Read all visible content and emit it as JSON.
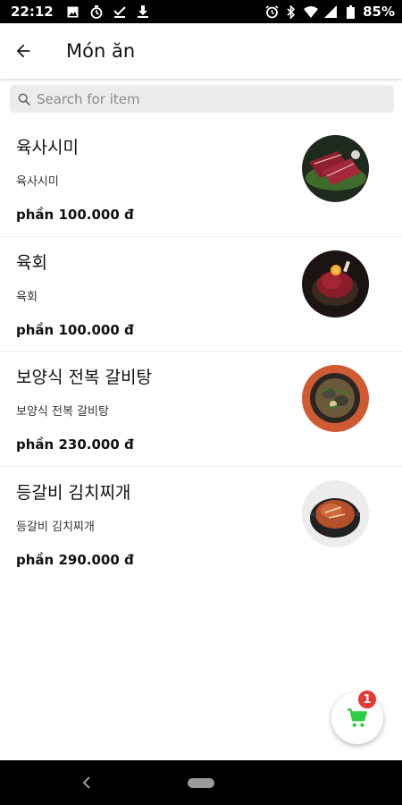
{
  "status_bar": {
    "time": "22:12",
    "battery": "85%",
    "left_icons": [
      "image-icon",
      "timer-icon",
      "check-icon",
      "download-icon"
    ],
    "right_icons": [
      "alarm-icon",
      "bluetooth-icon",
      "wifi-icon",
      "signal-icon",
      "battery-icon"
    ]
  },
  "app_bar": {
    "title": "Món ăn",
    "back_icon": "arrow-left-icon"
  },
  "search": {
    "placeholder": "Search for item"
  },
  "items": [
    {
      "name": "육사시미",
      "description": "육사시미",
      "price": "phần 100.000 đ",
      "thumb": "raw-beef-slices"
    },
    {
      "name": "육회",
      "description": "육회",
      "price": "phần 100.000 đ",
      "thumb": "beef-tartare"
    },
    {
      "name": "보양식 전복 갈비탕",
      "description": "보양식 전복 갈비탕",
      "price": "phần 230.000 đ",
      "thumb": "abalone-galbitang"
    },
    {
      "name": "등갈비 김치찌개",
      "description": "등갈비 김치찌개",
      "price": "phần 290.000 đ",
      "thumb": "kimchi-stew"
    }
  ],
  "cart": {
    "count": "1",
    "accent_color": "#2ecc40",
    "badge_color": "#e53935"
  }
}
